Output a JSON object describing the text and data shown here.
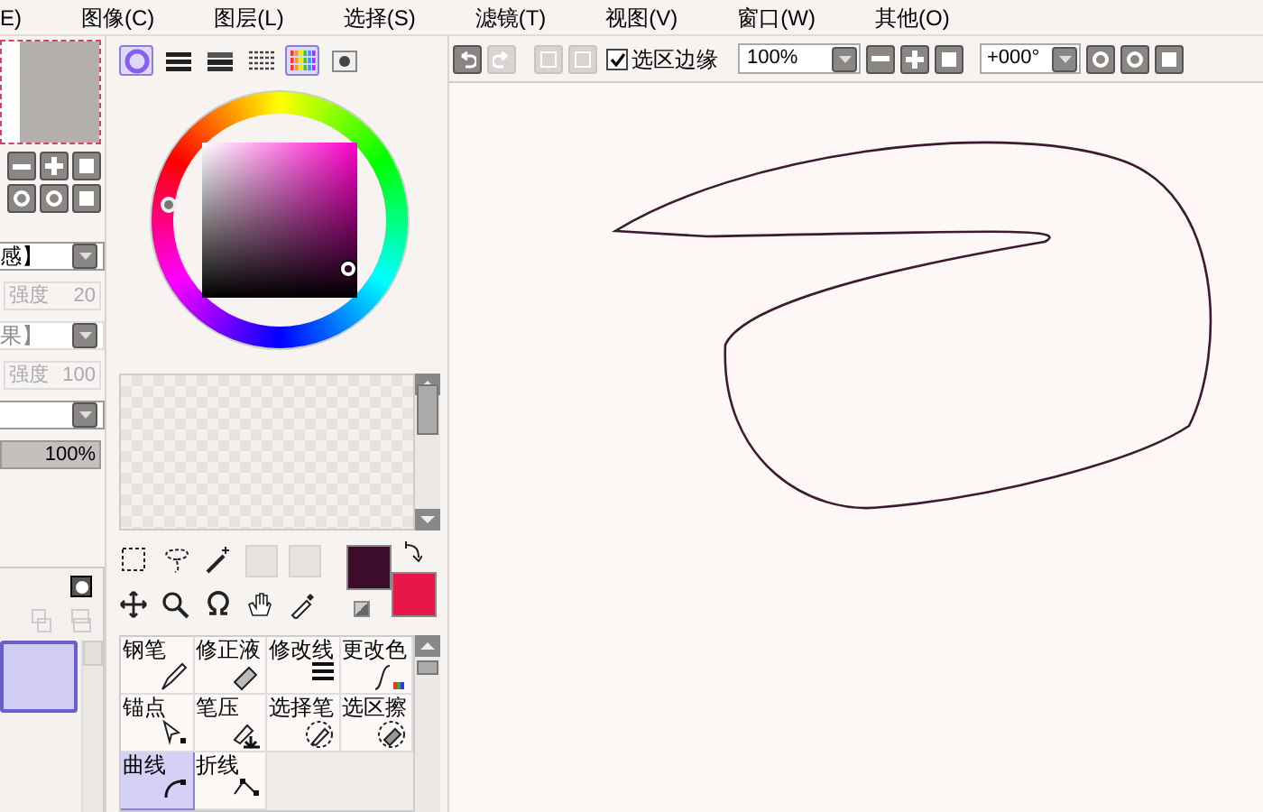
{
  "menu": [
    "E)",
    "图像(C)",
    "图层(L)",
    "选择(S)",
    "滤镜(T)",
    "视图(V)",
    "窗口(W)",
    "其他(O)"
  ],
  "left_panel": [
    {
      "kind": "select",
      "value": "感】",
      "disabled": false
    },
    {
      "kind": "field",
      "label": "强度",
      "value": "20",
      "disabled": true
    },
    {
      "kind": "select",
      "value": "果】",
      "disabled": true
    },
    {
      "kind": "field",
      "label": "强度",
      "value": "100",
      "disabled": true
    },
    {
      "kind": "select",
      "disabled": false
    },
    {
      "kind": "meter",
      "reading": "100%",
      "level": 1
    }
  ],
  "layers": [
    {
      "selected": true
    }
  ],
  "color_tabs": [
    {
      "kind": "wheel",
      "selected": true
    },
    {
      "kind": "bars",
      "selected": false
    },
    {
      "kind": "bars2",
      "selected": false
    },
    {
      "kind": "lines",
      "selected": false
    },
    {
      "kind": "palette",
      "selected": true
    },
    {
      "kind": "blob",
      "selected": false
    }
  ],
  "swatches": [
    {
      "color": "#3c0d2a"
    },
    {
      "color": "#e8174a"
    }
  ],
  "brush_tools": [
    {
      "kind": "pen",
      "label": "钢笔",
      "selected": false
    },
    {
      "kind": "eraser",
      "label": "修正液",
      "selected": false
    },
    {
      "kind": "lines",
      "label": "修改线",
      "selected": false
    },
    {
      "kind": "recolor",
      "label": "更改色",
      "selected": false
    },
    {
      "kind": "anchor",
      "label": "锚点",
      "selected": false
    },
    {
      "kind": "pressure",
      "label": "笔压",
      "selected": false
    },
    {
      "kind": "selpen",
      "label": "选择笔",
      "selected": false
    },
    {
      "kind": "selerase",
      "label": "选区擦",
      "selected": false
    },
    {
      "kind": "curve",
      "label": "曲线",
      "selected": true
    },
    {
      "kind": "polyline",
      "label": "折线",
      "selected": false
    }
  ],
  "toolbar": {
    "selection_edge": {
      "label": "选区边缘",
      "checked": true
    },
    "zoom": "100%",
    "angle": "+000°"
  }
}
